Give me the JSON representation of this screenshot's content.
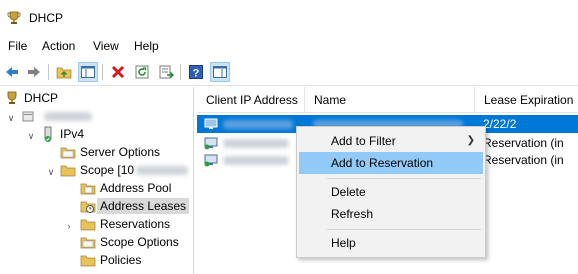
{
  "window": {
    "title": "DHCP",
    "icon": "dhcp-trophy-icon"
  },
  "menubar": {
    "items": [
      "File",
      "Action",
      "View",
      "Help"
    ]
  },
  "toolbar": {
    "buttons": [
      "back-arrow-icon",
      "forward-arrow-icon",
      "up-folder-icon",
      "show-hide-tree-icon",
      "delete-icon",
      "refresh-icon",
      "export-list-icon",
      "help-icon",
      "console-tree-icon"
    ]
  },
  "tree": {
    "root": "DHCP",
    "ipv4": "IPv4",
    "server_options": "Server Options",
    "scope": "Scope [10",
    "address_pool": "Address Pool",
    "address_leases": "Address Leases",
    "reservations": "Reservations",
    "scope_options": "Scope Options",
    "policies": "Policies"
  },
  "list": {
    "columns": [
      "Client IP Address",
      "Name",
      "Lease Expiration"
    ],
    "rows": [
      {
        "lease": "2/22/2",
        "selected": true
      },
      {
        "lease": "Reservation (in",
        "selected": false
      },
      {
        "lease": "Reservation (in",
        "selected": false
      }
    ]
  },
  "context_menu": {
    "items": [
      "Add to Filter",
      "Add to Reservation",
      "Delete",
      "Refresh",
      "Help"
    ],
    "highlighted": "Add to Reservation"
  },
  "colors": {
    "selection": "#0078d7",
    "menu_highlight": "#91c9f7",
    "menu_bg": "#f2f2f2"
  }
}
